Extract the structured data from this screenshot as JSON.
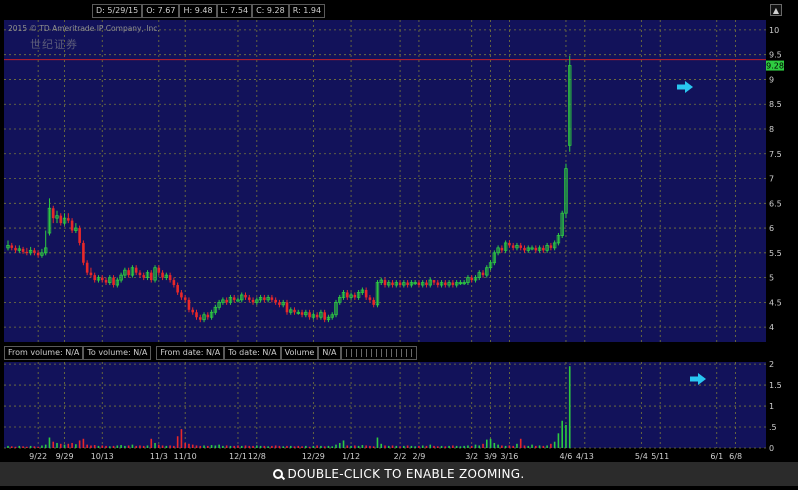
{
  "info": {
    "date": "D: 5/29/15",
    "open": "O: 7.67",
    "high": "H: 9.48",
    "low": "L: 7.54",
    "close": "C: 9.28",
    "range": "R: 1.94"
  },
  "copyright": "2015 © TD Ameritrade IP Company, Inc.",
  "watermark": "世纪证券",
  "last_price_label": "9.28",
  "filters": {
    "from_volume": "From volume: N/A",
    "to_volume": "To volume: N/A",
    "from_date": "From date: N/A",
    "to_date": "To date: N/A",
    "volume": "Volume",
    "volume_value": "N/A"
  },
  "zoom_hint": "DOUBLE-CLICK TO ENABLE ZOOMING.",
  "colors": {
    "background": "#12125a",
    "grid": "#7a7a3a",
    "up": "#2ecc40",
    "down": "#e8282a",
    "arrow": "#29c6f0",
    "ref_line": "#c0202a"
  },
  "chart_data": [
    {
      "type": "candlestick",
      "title": "",
      "xlabel": "",
      "ylabel": "",
      "ylim": [
        3.7,
        10.2
      ],
      "yticks": [
        "10",
        "9.5",
        "9",
        "8.5",
        "8",
        "7.5",
        "7",
        "6.5",
        "6",
        "5.5",
        "5",
        "4.5",
        "4"
      ],
      "ytick_values": [
        10,
        9.5,
        9,
        8.5,
        8,
        7.5,
        7,
        6.5,
        6,
        5.5,
        5,
        4.5,
        4
      ],
      "reference_line": 9.4,
      "last_price": 9.28,
      "grid": true,
      "xticks": [
        "9/22",
        "9/29",
        "10/13",
        "11/3",
        "11/10",
        "12/1",
        "12/8",
        "12/29",
        "1/12",
        "2/2",
        "2/9",
        "3/2",
        "3/9",
        "3/16",
        "4/6",
        "4/13",
        "5/4",
        "5/11",
        "6/1",
        "6/8"
      ],
      "xtick_index": [
        8,
        15,
        25,
        40,
        47,
        61,
        66,
        81,
        91,
        104,
        109,
        123,
        128,
        133,
        148,
        153,
        168,
        173,
        188,
        193
      ],
      "close": [
        5.65,
        5.6,
        5.55,
        5.58,
        5.52,
        5.5,
        5.55,
        5.5,
        5.45,
        5.5,
        5.6,
        6.4,
        6.2,
        6.25,
        6.1,
        6.2,
        6.15,
        5.95,
        6.0,
        5.7,
        5.3,
        5.1,
        5.05,
        4.95,
        5.0,
        4.95,
        4.9,
        5.0,
        4.85,
        4.95,
        5.05,
        5.15,
        5.05,
        5.2,
        5.1,
        5.05,
        5.0,
        5.1,
        4.95,
        5.2,
        5.1,
        5.0,
        5.05,
        4.95,
        4.85,
        4.7,
        4.6,
        4.55,
        4.35,
        4.3,
        4.2,
        4.15,
        4.25,
        4.2,
        4.3,
        4.4,
        4.5,
        4.55,
        4.5,
        4.6,
        4.55,
        4.55,
        4.65,
        4.6,
        4.55,
        4.5,
        4.55,
        4.6,
        4.55,
        4.6,
        4.55,
        4.5,
        4.45,
        4.5,
        4.3,
        4.35,
        4.3,
        4.3,
        4.25,
        4.3,
        4.2,
        4.25,
        4.2,
        4.3,
        4.15,
        4.2,
        4.25,
        4.5,
        4.6,
        4.7,
        4.6,
        4.65,
        4.6,
        4.7,
        4.75,
        4.6,
        4.55,
        4.45,
        4.9,
        4.95,
        4.85,
        4.9,
        4.85,
        4.9,
        4.85,
        4.9,
        4.85,
        4.9,
        4.9,
        4.85,
        4.9,
        4.85,
        4.95,
        4.9,
        4.85,
        4.9,
        4.85,
        4.9,
        4.85,
        4.9,
        4.9,
        4.9,
        5.0,
        4.95,
        5.0,
        5.1,
        5.05,
        5.2,
        5.3,
        5.5,
        5.6,
        5.55,
        5.7,
        5.65,
        5.6,
        5.65,
        5.6,
        5.55,
        5.6,
        5.6,
        5.55,
        5.6,
        5.55,
        5.65,
        5.6,
        5.7,
        5.85,
        6.3,
        7.2,
        9.28
      ],
      "open": [
        5.6,
        5.65,
        5.6,
        5.55,
        5.58,
        5.52,
        5.5,
        5.55,
        5.5,
        5.45,
        5.5,
        5.9,
        6.4,
        6.2,
        6.25,
        6.1,
        6.2,
        6.15,
        5.95,
        6.0,
        5.7,
        5.3,
        5.1,
        5.05,
        4.95,
        5.0,
        4.95,
        4.9,
        5.0,
        4.85,
        4.95,
        5.05,
        5.15,
        5.05,
        5.2,
        5.1,
        5.05,
        5.0,
        5.1,
        4.95,
        5.2,
        5.1,
        5.0,
        5.05,
        4.95,
        4.85,
        4.7,
        4.6,
        4.55,
        4.35,
        4.3,
        4.2,
        4.15,
        4.25,
        4.2,
        4.3,
        4.4,
        4.5,
        4.55,
        4.5,
        4.6,
        4.55,
        4.55,
        4.65,
        4.6,
        4.55,
        4.5,
        4.55,
        4.6,
        4.55,
        4.6,
        4.55,
        4.5,
        4.45,
        4.5,
        4.3,
        4.35,
        4.3,
        4.3,
        4.25,
        4.3,
        4.2,
        4.25,
        4.2,
        4.3,
        4.15,
        4.2,
        4.25,
        4.5,
        4.6,
        4.7,
        4.6,
        4.65,
        4.6,
        4.7,
        4.75,
        4.6,
        4.55,
        4.45,
        4.9,
        4.95,
        4.85,
        4.9,
        4.85,
        4.9,
        4.85,
        4.9,
        4.85,
        4.9,
        4.9,
        4.85,
        4.9,
        4.85,
        4.95,
        4.9,
        4.85,
        4.9,
        4.85,
        4.9,
        4.85,
        4.9,
        4.9,
        4.9,
        5.0,
        4.95,
        5.0,
        5.1,
        5.05,
        5.2,
        5.3,
        5.5,
        5.6,
        5.55,
        5.7,
        5.65,
        5.6,
        5.65,
        5.6,
        5.55,
        5.6,
        5.6,
        5.55,
        5.6,
        5.55,
        5.65,
        5.6,
        5.7,
        5.85,
        6.3,
        7.67
      ],
      "high": [
        5.75,
        5.7,
        5.65,
        5.65,
        5.62,
        5.6,
        5.62,
        5.6,
        5.55,
        5.58,
        5.95,
        6.6,
        6.45,
        6.35,
        6.3,
        6.3,
        6.3,
        6.2,
        6.1,
        6.05,
        5.75,
        5.35,
        5.2,
        5.1,
        5.05,
        5.05,
        5.0,
        5.05,
        5.05,
        5.0,
        5.1,
        5.2,
        5.2,
        5.25,
        5.25,
        5.15,
        5.1,
        5.15,
        5.15,
        5.25,
        5.25,
        5.15,
        5.1,
        5.1,
        5.0,
        4.9,
        4.75,
        4.65,
        4.6,
        4.4,
        4.35,
        4.25,
        4.3,
        4.3,
        4.35,
        4.45,
        4.55,
        4.6,
        4.6,
        4.65,
        4.65,
        4.6,
        4.7,
        4.7,
        4.65,
        4.6,
        4.6,
        4.65,
        4.65,
        4.65,
        4.65,
        4.6,
        4.55,
        4.55,
        4.55,
        4.4,
        4.4,
        4.35,
        4.35,
        4.35,
        4.35,
        4.3,
        4.3,
        4.35,
        4.35,
        4.25,
        4.3,
        4.55,
        4.65,
        4.75,
        4.75,
        4.7,
        4.7,
        4.75,
        4.8,
        4.8,
        4.65,
        4.6,
        4.95,
        5.0,
        5.0,
        4.95,
        4.95,
        4.95,
        4.95,
        4.95,
        4.95,
        4.95,
        4.95,
        4.95,
        4.95,
        4.95,
        5.0,
        4.95,
        4.95,
        4.95,
        4.95,
        4.95,
        4.95,
        4.95,
        4.95,
        4.95,
        5.05,
        5.05,
        5.05,
        5.15,
        5.15,
        5.25,
        5.35,
        5.55,
        5.65,
        5.65,
        5.75,
        5.75,
        5.7,
        5.7,
        5.7,
        5.65,
        5.65,
        5.65,
        5.65,
        5.65,
        5.65,
        5.7,
        5.7,
        5.75,
        5.9,
        6.35,
        7.3,
        9.48
      ],
      "low": [
        5.55,
        5.55,
        5.5,
        5.5,
        5.48,
        5.45,
        5.45,
        5.45,
        5.4,
        5.4,
        5.45,
        5.85,
        6.1,
        6.1,
        6.05,
        6.05,
        6.1,
        5.9,
        5.9,
        5.65,
        5.25,
        5.05,
        5.0,
        4.9,
        4.9,
        4.9,
        4.85,
        4.85,
        4.8,
        4.8,
        4.9,
        5.0,
        5.0,
        5.0,
        5.05,
        5.0,
        4.95,
        4.95,
        4.9,
        4.9,
        5.05,
        4.95,
        4.95,
        4.9,
        4.8,
        4.65,
        4.55,
        4.5,
        4.3,
        4.25,
        4.15,
        4.1,
        4.1,
        4.15,
        4.15,
        4.25,
        4.35,
        4.45,
        4.45,
        4.45,
        4.5,
        4.5,
        4.5,
        4.55,
        4.5,
        4.45,
        4.45,
        4.5,
        4.5,
        4.5,
        4.5,
        4.45,
        4.4,
        4.4,
        4.25,
        4.25,
        4.25,
        4.25,
        4.2,
        4.2,
        4.15,
        4.15,
        4.15,
        4.15,
        4.1,
        4.1,
        4.15,
        4.2,
        4.45,
        4.55,
        4.55,
        4.55,
        4.55,
        4.55,
        4.65,
        4.55,
        4.5,
        4.4,
        4.4,
        4.85,
        4.8,
        4.8,
        4.8,
        4.8,
        4.8,
        4.8,
        4.8,
        4.8,
        4.85,
        4.8,
        4.8,
        4.8,
        4.8,
        4.85,
        4.8,
        4.8,
        4.8,
        4.8,
        4.8,
        4.8,
        4.85,
        4.85,
        4.85,
        4.9,
        4.9,
        4.95,
        5.0,
        5.0,
        5.15,
        5.25,
        5.45,
        5.5,
        5.5,
        5.6,
        5.55,
        5.55,
        5.55,
        5.5,
        5.5,
        5.55,
        5.5,
        5.5,
        5.5,
        5.5,
        5.55,
        5.55,
        5.65,
        5.8,
        6.2,
        7.54
      ]
    },
    {
      "type": "bar",
      "title": "Volume",
      "ylim": [
        0,
        2.05
      ],
      "yticks": [
        "2",
        "1.5",
        "1",
        ".5",
        "0"
      ],
      "ytick_values": [
        2,
        1.5,
        1,
        0.5,
        0
      ],
      "values": [
        0.05,
        0.04,
        0.03,
        0.05,
        0.04,
        0.03,
        0.05,
        0.04,
        0.03,
        0.06,
        0.08,
        0.25,
        0.15,
        0.12,
        0.1,
        0.08,
        0.1,
        0.12,
        0.09,
        0.18,
        0.22,
        0.08,
        0.06,
        0.07,
        0.05,
        0.06,
        0.05,
        0.04,
        0.05,
        0.06,
        0.07,
        0.05,
        0.06,
        0.08,
        0.05,
        0.06,
        0.05,
        0.06,
        0.22,
        0.12,
        0.08,
        0.06,
        0.05,
        0.06,
        0.05,
        0.28,
        0.45,
        0.12,
        0.1,
        0.08,
        0.06,
        0.05,
        0.06,
        0.05,
        0.07,
        0.06,
        0.08,
        0.05,
        0.06,
        0.05,
        0.05,
        0.06,
        0.05,
        0.06,
        0.05,
        0.05,
        0.06,
        0.05,
        0.05,
        0.04,
        0.05,
        0.06,
        0.05,
        0.04,
        0.05,
        0.05,
        0.04,
        0.05,
        0.04,
        0.05,
        0.03,
        0.05,
        0.06,
        0.05,
        0.04,
        0.05,
        0.04,
        0.08,
        0.12,
        0.18,
        0.06,
        0.05,
        0.06,
        0.05,
        0.07,
        0.06,
        0.05,
        0.04,
        0.25,
        0.1,
        0.06,
        0.05,
        0.06,
        0.05,
        0.04,
        0.05,
        0.06,
        0.05,
        0.04,
        0.05,
        0.06,
        0.05,
        0.08,
        0.05,
        0.04,
        0.05,
        0.04,
        0.05,
        0.06,
        0.05,
        0.04,
        0.05,
        0.06,
        0.05,
        0.08,
        0.06,
        0.1,
        0.2,
        0.22,
        0.12,
        0.08,
        0.06,
        0.05,
        0.06,
        0.05,
        0.1,
        0.22,
        0.06,
        0.05,
        0.08,
        0.05,
        0.06,
        0.05,
        0.06,
        0.1,
        0.15,
        0.35,
        0.65,
        0.55,
        1.95
      ],
      "up": [
        true,
        false,
        false,
        true,
        false,
        false,
        true,
        false,
        false,
        true,
        true,
        true,
        false,
        true,
        false,
        true,
        false,
        false,
        true,
        false,
        false,
        false,
        false,
        false,
        true,
        false,
        false,
        true,
        false,
        true,
        true,
        true,
        false,
        true,
        false,
        false,
        false,
        true,
        false,
        true,
        false,
        false,
        true,
        false,
        false,
        false,
        false,
        false,
        false,
        false,
        false,
        false,
        true,
        false,
        true,
        true,
        true,
        true,
        false,
        true,
        false,
        false,
        true,
        false,
        false,
        false,
        true,
        true,
        false,
        true,
        false,
        false,
        false,
        true,
        false,
        true,
        false,
        false,
        false,
        true,
        false,
        true,
        false,
        true,
        false,
        true,
        true,
        true,
        true,
        true,
        false,
        true,
        false,
        true,
        true,
        false,
        false,
        false,
        true,
        true,
        false,
        true,
        false,
        true,
        false,
        true,
        false,
        true,
        true,
        false,
        true,
        false,
        true,
        false,
        false,
        true,
        false,
        true,
        false,
        true,
        true,
        true,
        true,
        false,
        true,
        true,
        false,
        true,
        true,
        true,
        true,
        false,
        true,
        false,
        false,
        true,
        false,
        false,
        true,
        true,
        false,
        true,
        false,
        true,
        false,
        true,
        true,
        true,
        true,
        true
      ]
    }
  ]
}
